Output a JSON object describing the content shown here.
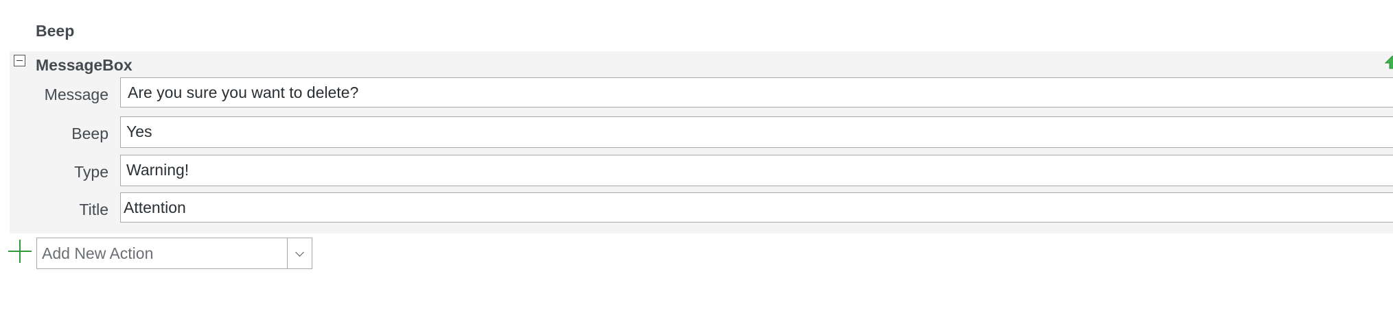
{
  "previous_action": {
    "title": "Beep"
  },
  "action": {
    "title": "MessageBox",
    "collapse_icon": "minus-box-icon",
    "move_up_icon": "green-up-arrow-icon",
    "params": [
      {
        "label": "Message",
        "value": "Are you sure you want to delete?"
      },
      {
        "label": "Beep",
        "value": "Yes"
      },
      {
        "label": "Type",
        "value": "Warning!"
      },
      {
        "label": "Title",
        "value": "Attention"
      }
    ]
  },
  "add_action": {
    "icon": "plus-icon",
    "placeholder": "Add New Action",
    "dropdown_icon": "chevron-down-icon"
  },
  "colors": {
    "panel_background": "#f4f4f5",
    "plus_green": "#2e9a3a",
    "move_up_green": "#3cb24a"
  }
}
